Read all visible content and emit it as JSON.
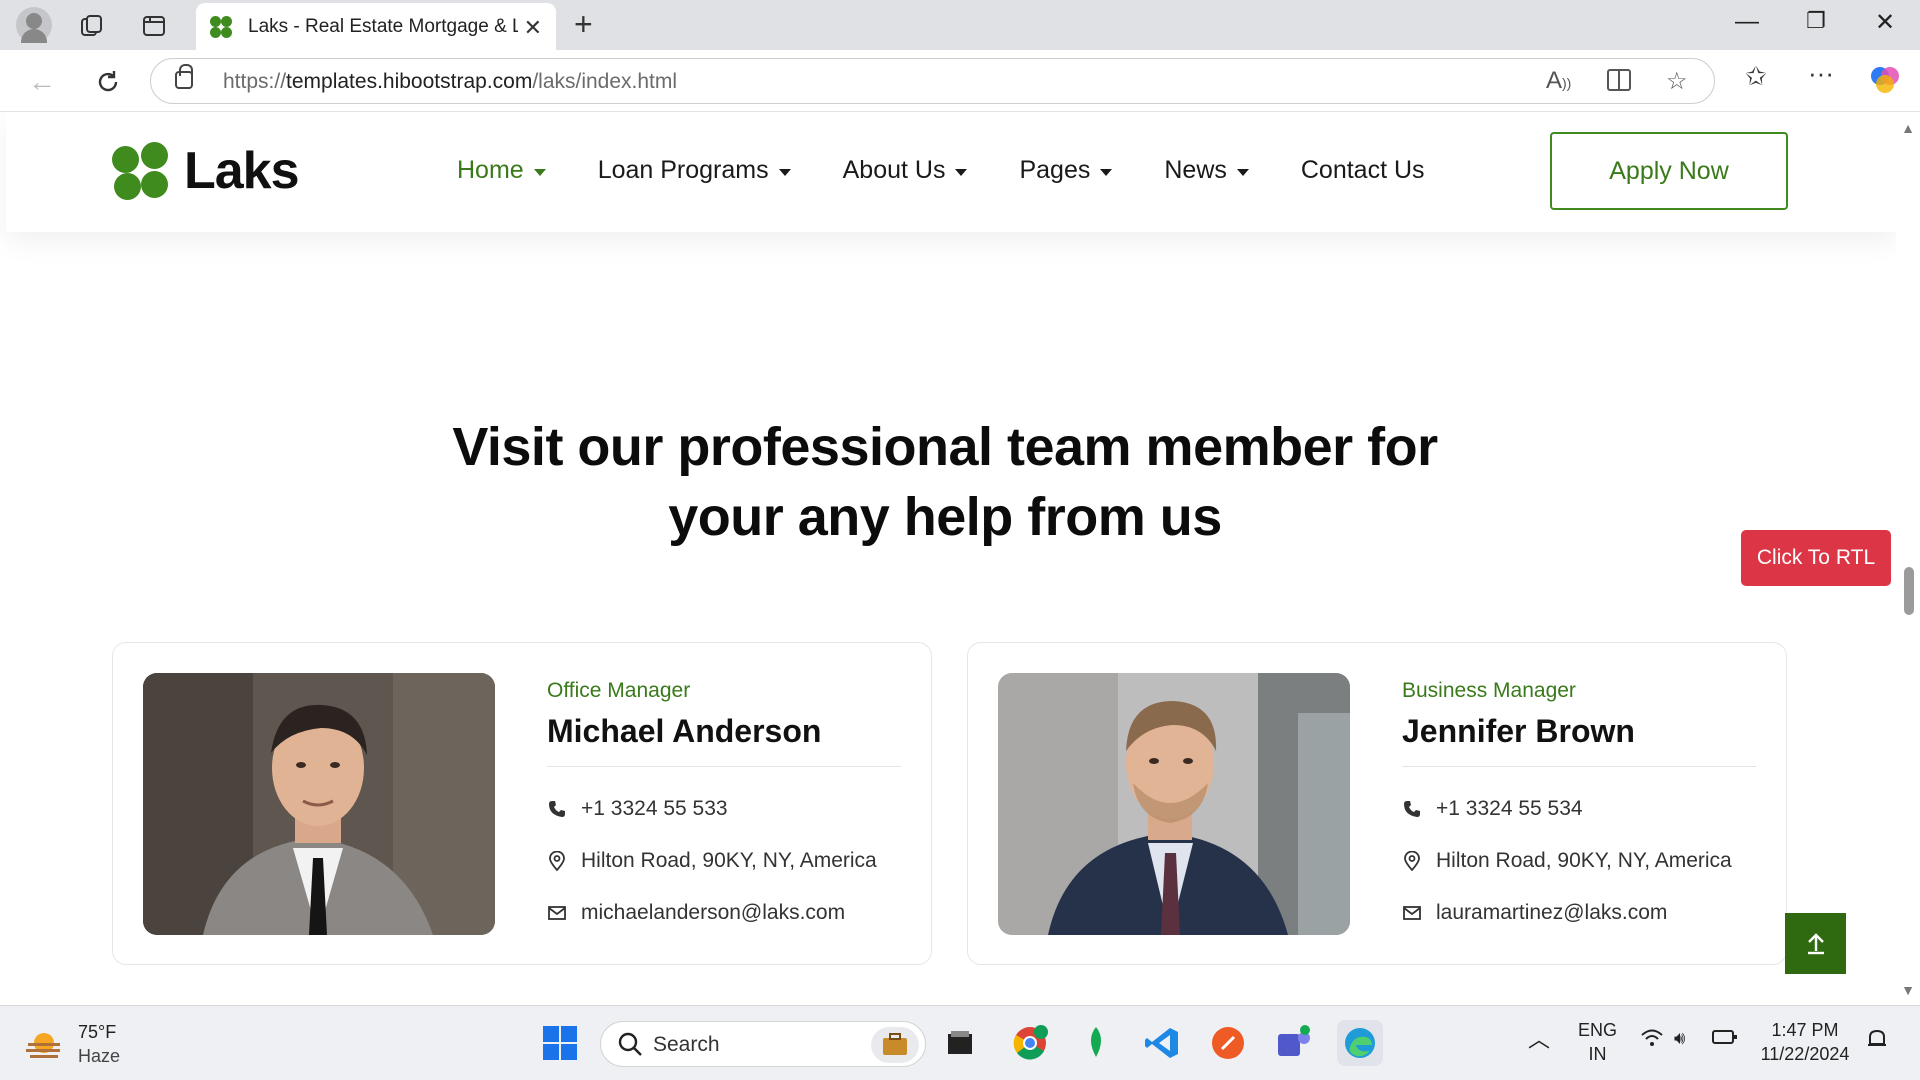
{
  "browser": {
    "tab_title": "Laks - Real Estate Mortgage & Lo",
    "url_proto": "https://",
    "url_host": "templates.hibootstrap.com",
    "url_path": "/laks/index.html"
  },
  "header": {
    "logo_text": "Laks",
    "menu": [
      {
        "label": "Home"
      },
      {
        "label": "Loan Programs"
      },
      {
        "label": "About Us"
      },
      {
        "label": "Pages"
      },
      {
        "label": "News"
      },
      {
        "label": "Contact Us"
      }
    ],
    "apply_label": "Apply Now"
  },
  "section": {
    "title_line1": "Visit our professional team member for",
    "title_line2": "your any help from us"
  },
  "rtl_button": "Click To RTL",
  "team": [
    {
      "role": "Office Manager",
      "name": "Michael Anderson",
      "phone": "+1 3324 55 533",
      "address": "Hilton Road, 90KY, NY, America",
      "email": "michaelanderson@laks.com"
    },
    {
      "role": "Business Manager",
      "name": "Jennifer Brown",
      "phone": "+1 3324 55 534",
      "address": "Hilton Road, 90KY, NY, America",
      "email": "lauramartinez@laks.com"
    }
  ],
  "taskbar": {
    "temp": "75°F",
    "condition": "Haze",
    "search": "Search",
    "lang1": "ENG",
    "lang2": "IN",
    "time": "1:47 PM",
    "date": "11/22/2024"
  },
  "colors": {
    "brand_green": "#3f8b1e",
    "rtl_red": "#dc3545"
  }
}
